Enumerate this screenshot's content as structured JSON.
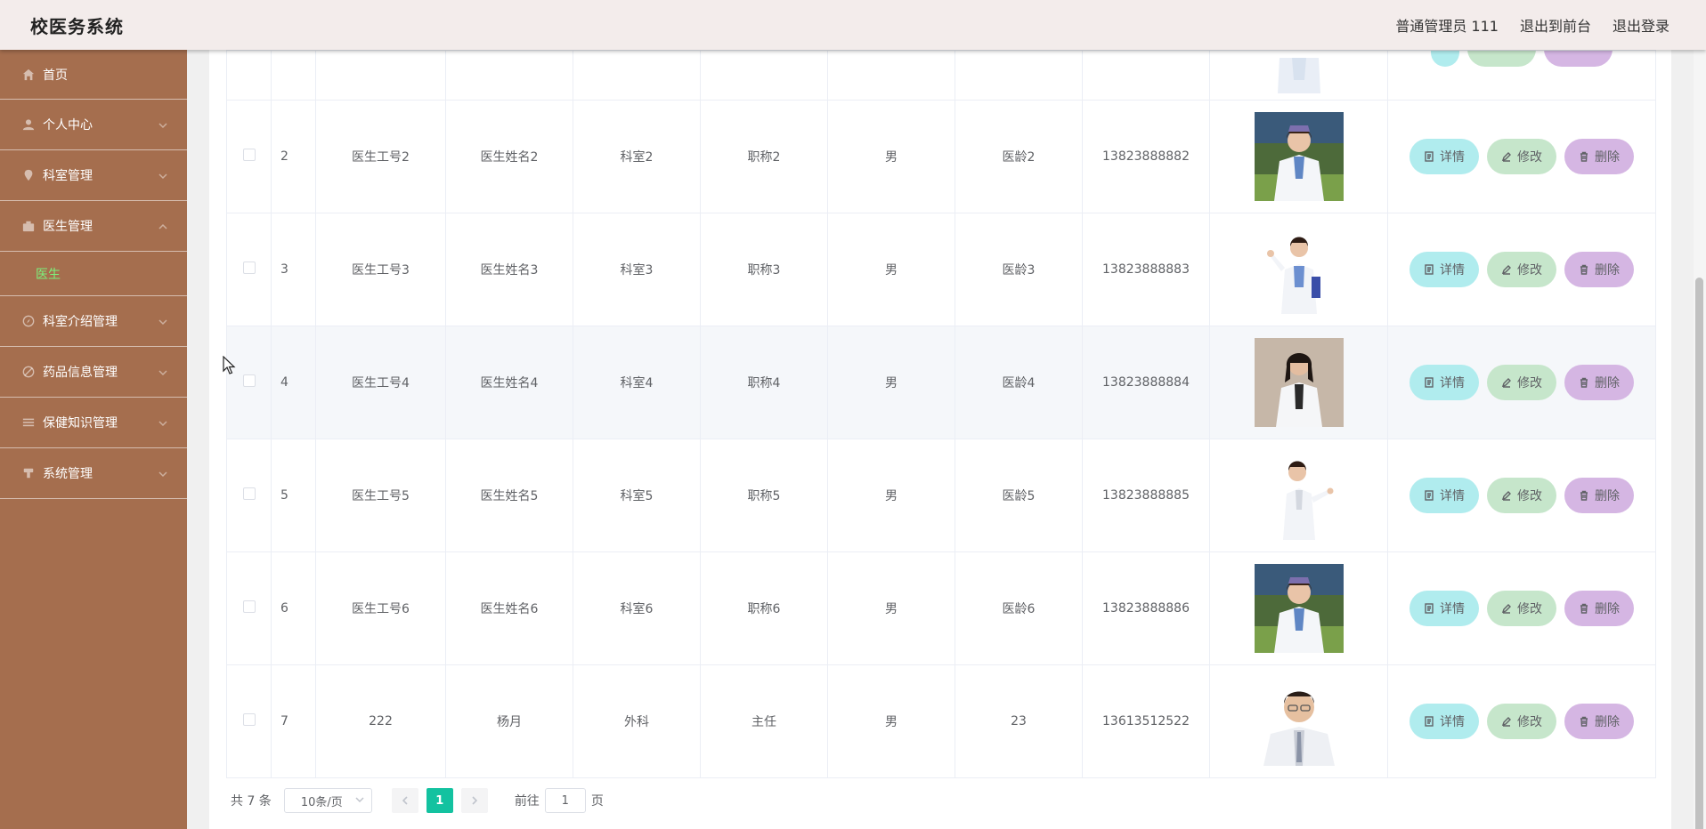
{
  "app": {
    "title": "校医务系统"
  },
  "header": {
    "user": "普通管理员 111",
    "back_to_front": "退出到前台",
    "logout": "退出登录"
  },
  "sidebar": {
    "items": [
      {
        "label": "首页",
        "icon": "home-icon"
      },
      {
        "label": "个人中心",
        "icon": "user-icon"
      },
      {
        "label": "科室管理",
        "icon": "location-icon"
      },
      {
        "label": "医生管理",
        "icon": "suitcase-icon",
        "expanded": true,
        "children": [
          {
            "label": "医生",
            "active": true
          }
        ]
      },
      {
        "label": "科室介绍管理",
        "icon": "compass-icon"
      },
      {
        "label": "药品信息管理",
        "icon": "slash-circle-icon"
      },
      {
        "label": "保健知识管理",
        "icon": "menu-lines-icon"
      },
      {
        "label": "系统管理",
        "icon": "setting-icon"
      }
    ]
  },
  "table": {
    "rows": [
      {
        "index": "2",
        "id": "医生工号2",
        "name": "医生姓名2",
        "dept": "科室2",
        "title": "职称2",
        "gender": "男",
        "years": "医龄2",
        "phone": "13823888882"
      },
      {
        "index": "3",
        "id": "医生工号3",
        "name": "医生姓名3",
        "dept": "科室3",
        "title": "职称3",
        "gender": "男",
        "years": "医龄3",
        "phone": "13823888883"
      },
      {
        "index": "4",
        "id": "医生工号4",
        "name": "医生姓名4",
        "dept": "科室4",
        "title": "职称4",
        "gender": "男",
        "years": "医龄4",
        "phone": "13823888884"
      },
      {
        "index": "5",
        "id": "医生工号5",
        "name": "医生姓名5",
        "dept": "科室5",
        "title": "职称5",
        "gender": "男",
        "years": "医龄5",
        "phone": "13823888885"
      },
      {
        "index": "6",
        "id": "医生工号6",
        "name": "医生姓名6",
        "dept": "科室6",
        "title": "职称6",
        "gender": "男",
        "years": "医龄6",
        "phone": "13823888886"
      },
      {
        "index": "7",
        "id": "222",
        "name": "杨月",
        "dept": "外科",
        "title": "主任",
        "gender": "男",
        "years": "23",
        "phone": "13613512522"
      }
    ],
    "actions": {
      "detail": "详情",
      "edit": "修改",
      "delete": "删除"
    }
  },
  "pagination": {
    "total": "共 7 条",
    "page_size": "10条/页",
    "current_page": "1",
    "goto_label": "前往",
    "goto_value": "1",
    "page_suffix": "页"
  },
  "colors": {
    "header_bg": "#f3eceb",
    "sidebar_bg": "#a56e4e",
    "active_submenu": "#7cf27c",
    "detail_btn": "#b0ecee",
    "edit_btn": "#c6e6cb",
    "delete_btn": "#d5b6e3",
    "current_page": "#13c2a0"
  }
}
